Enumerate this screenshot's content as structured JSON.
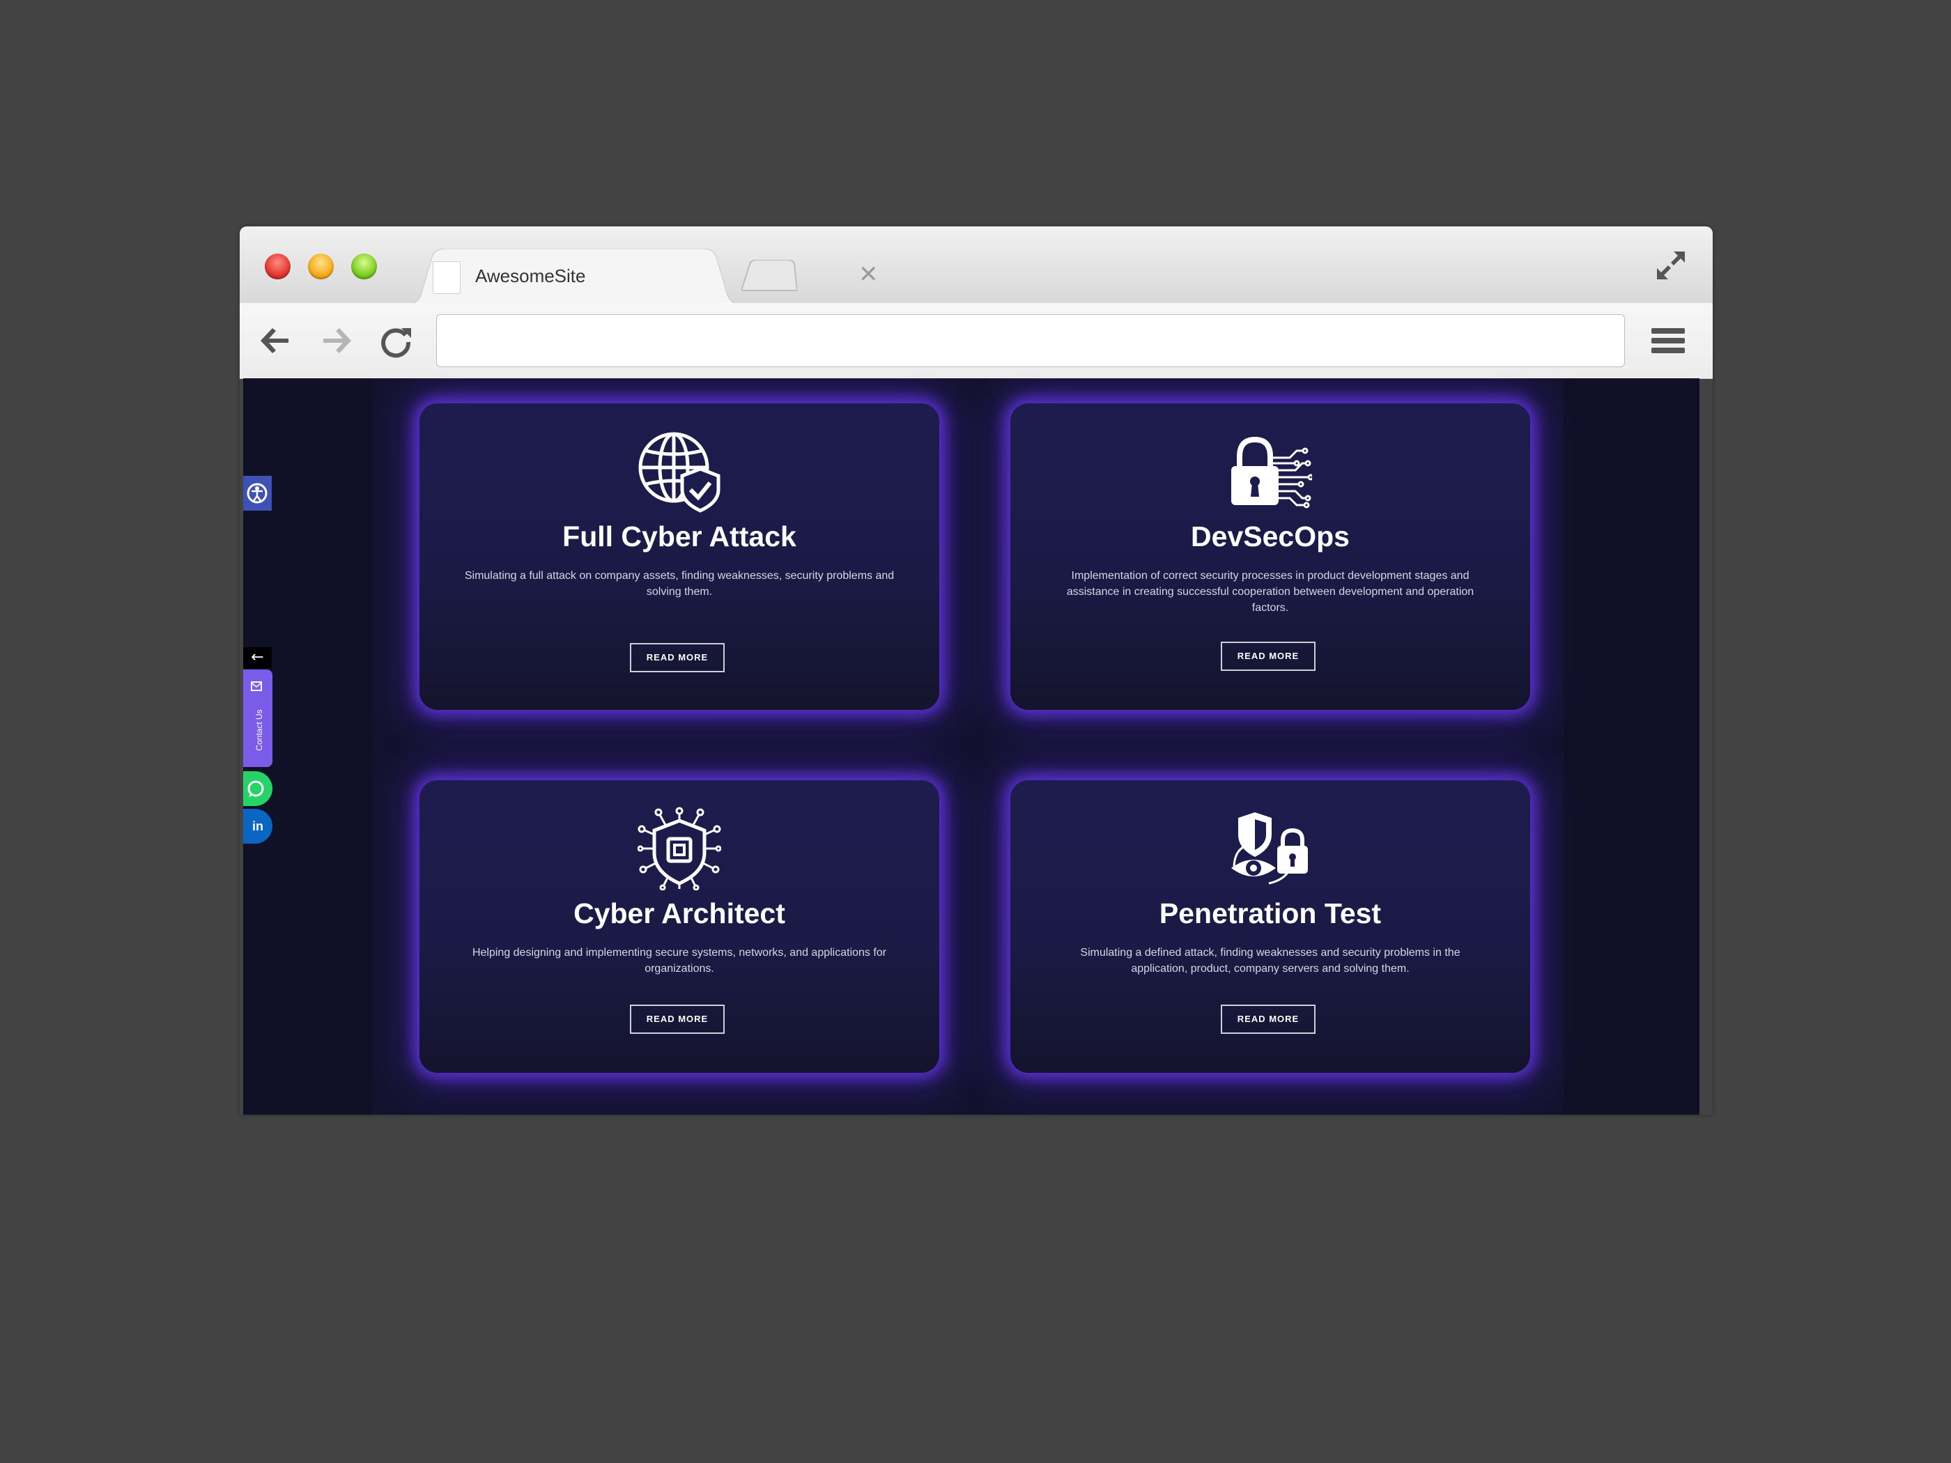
{
  "browser": {
    "tab_title": "AwesomeSite",
    "tab_close": "✕",
    "address": ""
  },
  "sidebar": {
    "back_arrow": "←",
    "contact_label": "Contact Us",
    "linkedin_label": "in"
  },
  "cards": [
    {
      "title": "Full Cyber Attack",
      "description": "Simulating a full attack on company assets, finding weaknesses, security problems and solving them.",
      "button": "READ MORE",
      "icon": "globe-shield-icon"
    },
    {
      "title": "DevSecOps",
      "description": "Implementation of correct security processes in product development stages and assistance in creating successful cooperation between development and operation factors.",
      "button": "READ MORE",
      "icon": "lock-circuit-icon"
    },
    {
      "title": "Cyber Architect",
      "description": "Helping designing and implementing secure systems, networks, and applications for organizations.",
      "button": "READ MORE",
      "icon": "chip-network-icon"
    },
    {
      "title": "Penetration Test",
      "description": "Simulating a defined attack, finding weaknesses and security problems in the application, product, company servers and solving them.",
      "button": "READ MORE",
      "icon": "shield-eye-lock-icon"
    }
  ],
  "colors": {
    "page_background": "#434343",
    "site_background": "#101026",
    "card_glow": "#6e3cff",
    "contact_tab": "#7b5ce8",
    "whatsapp": "#25d366",
    "linkedin": "#0a66c2",
    "accessibility": "#3f51b5"
  }
}
